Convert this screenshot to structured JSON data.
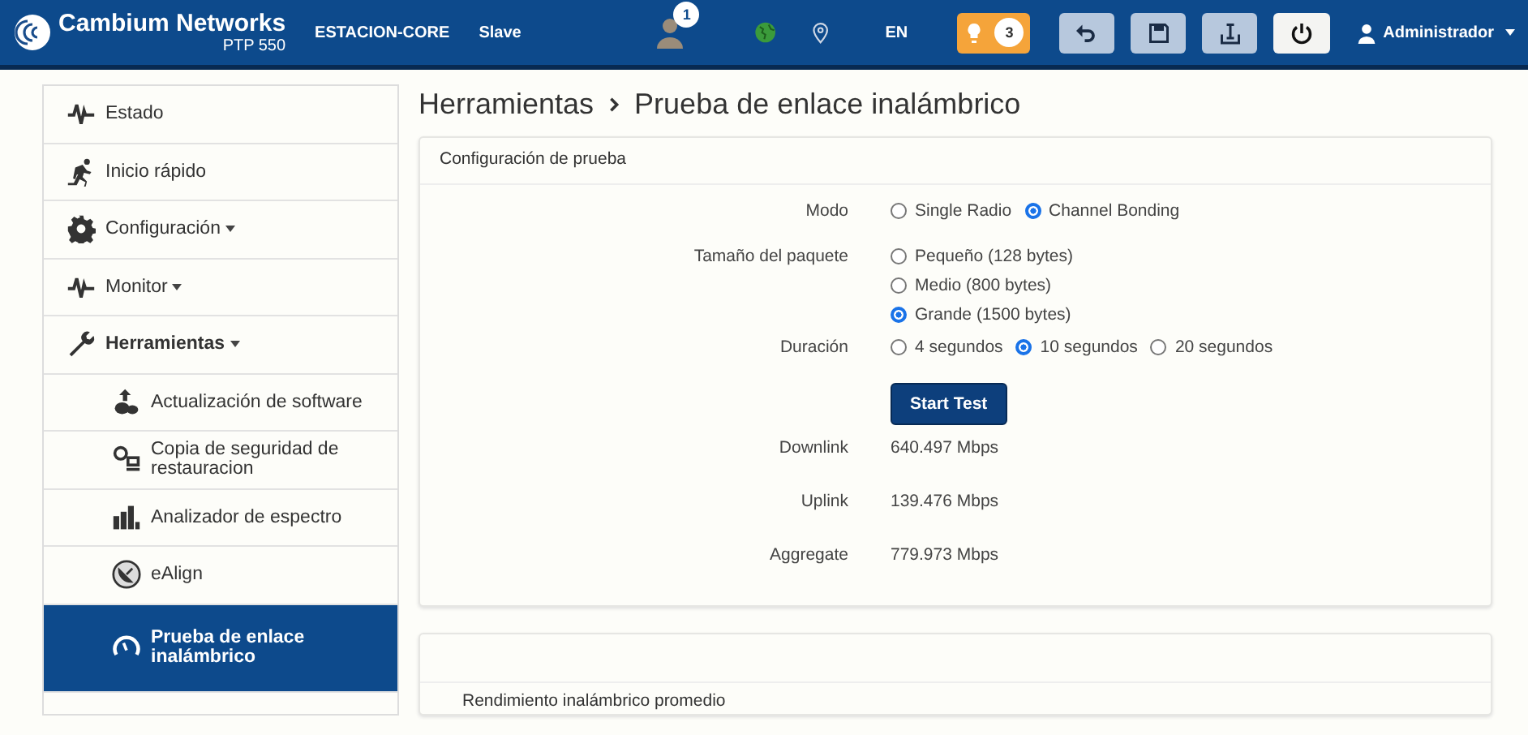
{
  "header": {
    "brand": "Cambium Networks",
    "model": "PTP 550",
    "device_name": "ESTACION-CORE",
    "role": "Slave",
    "user_badge": "1",
    "language": "EN",
    "alerts_count": "3",
    "user": "Administrador"
  },
  "sidebar": {
    "items": [
      {
        "label": "Estado",
        "selected": false
      },
      {
        "label": "Inicio rápido",
        "selected": false
      },
      {
        "label": "Configuración",
        "expanded": false,
        "selected": false
      },
      {
        "label": "Monitor",
        "expanded": false,
        "selected": false
      },
      {
        "label": "Herramientas",
        "expanded": true,
        "selected": false,
        "children": [
          {
            "label": "Actualización de software",
            "selected": false
          },
          {
            "label": "Copia de seguridad de restauracion",
            "selected": false
          },
          {
            "label": "Analizador de espectro",
            "selected": false
          },
          {
            "label": "eAlign",
            "selected": false
          },
          {
            "label": "Prueba de enlace inalámbrico",
            "selected": true
          }
        ]
      }
    ]
  },
  "breadcrumb": [
    "Herramientas",
    "Prueba de enlace inalámbrico"
  ],
  "config_panel": {
    "title": "Configuración de prueba",
    "fields": [
      {
        "label": "Modo",
        "kind": "radio",
        "options": [
          {
            "label": "Single Radio",
            "selected": false
          },
          {
            "label": "Channel Bonding",
            "selected": true
          }
        ]
      },
      {
        "label": "Tamaño del paquete",
        "kind": "radio_list",
        "options": [
          {
            "label": "Pequeño (128 bytes)",
            "selected": false
          },
          {
            "label": "Medio (800 bytes)",
            "selected": false
          },
          {
            "label": "Grande (1500 bytes)",
            "selected": true
          }
        ]
      },
      {
        "label": "Duración",
        "kind": "radio",
        "options": [
          {
            "label": "4 segundos",
            "selected": false
          },
          {
            "label": "10 segundos",
            "selected": true
          },
          {
            "label": "20 segundos",
            "selected": false
          }
        ]
      },
      {
        "kind": "button",
        "label": "Start Test"
      },
      {
        "label": "Downlink",
        "kind": "value",
        "value": "640.497 Mbps"
      },
      {
        "label": "Uplink",
        "kind": "value",
        "value": "139.476 Mbps"
      },
      {
        "label": "Aggregate",
        "kind": "value",
        "value": "779.973 Mbps"
      }
    ]
  },
  "second_panel": {
    "title": "Rendimiento inalámbrico promedio"
  }
}
